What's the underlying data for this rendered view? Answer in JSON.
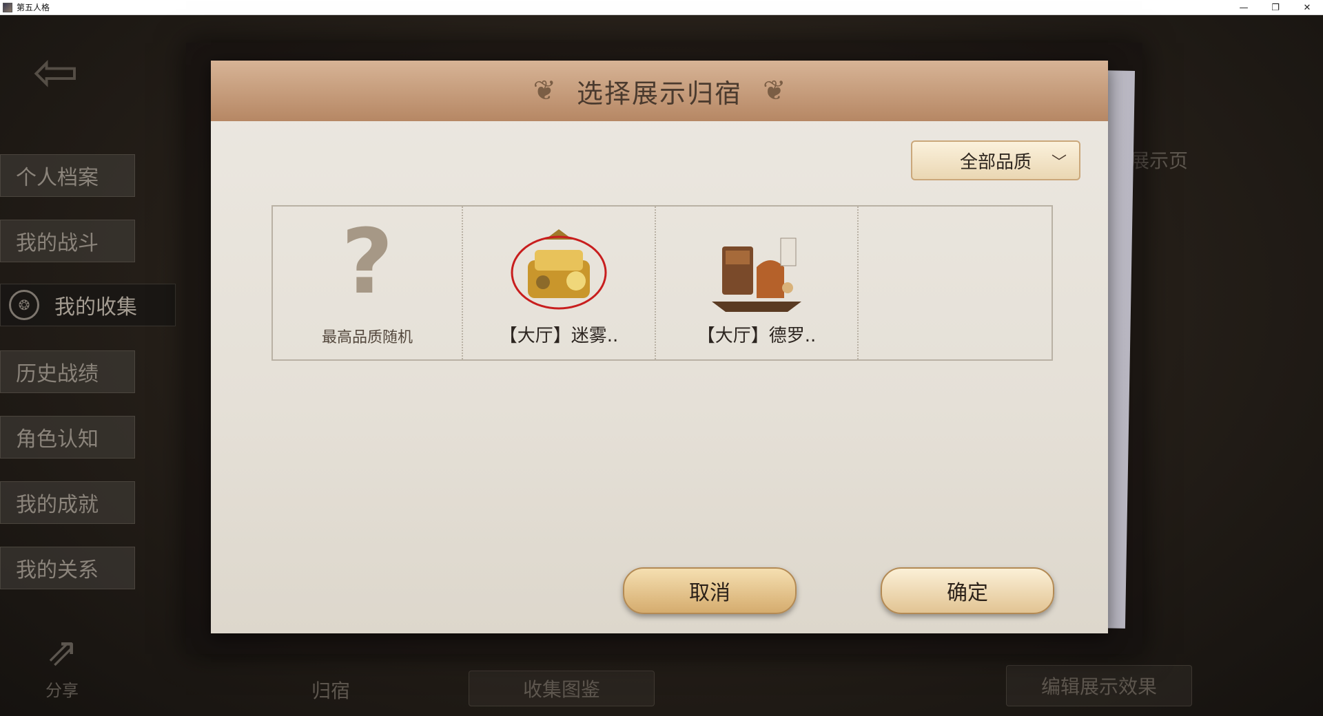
{
  "window": {
    "title": "第五人格",
    "controls": {
      "minimize": "—",
      "restore": "❐",
      "close": "✕"
    }
  },
  "background": {
    "side_menu": [
      {
        "label": "个人档案"
      },
      {
        "label": "我的战斗"
      },
      {
        "label": "我的收集",
        "active": true
      },
      {
        "label": "历史战绩"
      },
      {
        "label": "角色认知"
      },
      {
        "label": "我的成就"
      },
      {
        "label": "我的关系"
      }
    ],
    "share_label": "分享",
    "bottom_tab_label": "归宿",
    "collection_button_label": "收集图鉴",
    "edit_button_label": "编辑展示效果",
    "right_fragment_text": "展示页"
  },
  "dialog": {
    "title": "选择展示归宿",
    "filter": {
      "selected": "全部品质"
    },
    "items": [
      {
        "label": "最高品质随机",
        "icon": "question-mark-icon"
      },
      {
        "label": "【大厅】迷雾..",
        "icon": "lobby-mist-thumbnail",
        "selected": true
      },
      {
        "label": "【大厅】德罗..",
        "icon": "lobby-drawing-room-thumbnail"
      },
      {
        "label": ""
      }
    ],
    "cancel_label": "取消",
    "confirm_label": "确定"
  },
  "colors": {
    "header": "#b68764",
    "paper": "#e8e3da",
    "button": "#e2c493",
    "selection_ring": "#c81e1e"
  }
}
